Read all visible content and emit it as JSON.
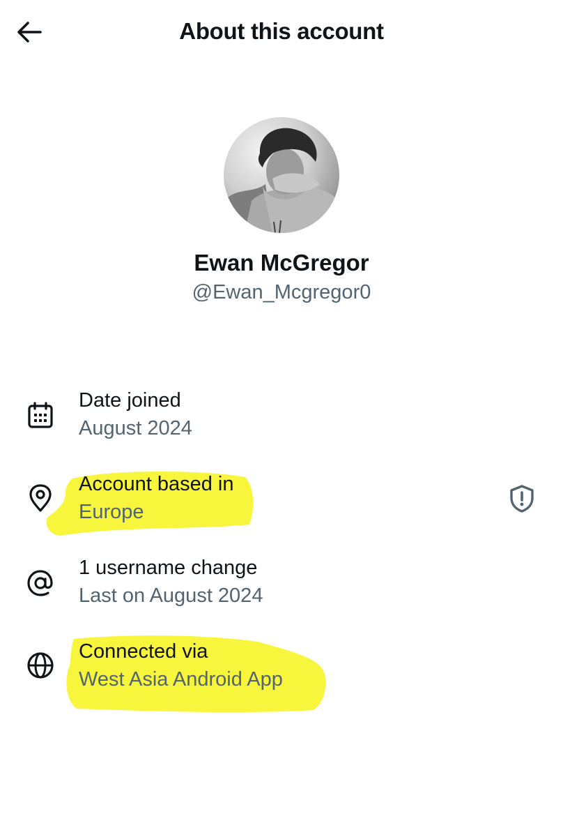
{
  "header": {
    "back_icon": "arrow-left-icon",
    "title": "About this account"
  },
  "profile": {
    "name": "Ewan McGregor",
    "handle": "@Ewan_Mcgregor0"
  },
  "rows": [
    {
      "icon": "calendar-icon",
      "label": "Date joined",
      "value": "August 2024",
      "highlighted": false
    },
    {
      "icon": "location-pin-icon",
      "label": "Account based in",
      "value": "Europe",
      "highlighted": true
    },
    {
      "icon": "at-sign-icon",
      "label": "1 username change",
      "value": "Last on August 2024",
      "highlighted": false
    },
    {
      "icon": "globe-icon",
      "label": "Connected via",
      "value": "West Asia Android App",
      "highlighted": true
    }
  ],
  "shield_icon": "shield-alert-icon",
  "colors": {
    "primary_text": "#0f1419",
    "secondary_text": "#536471",
    "highlighter": "#f6f52c"
  }
}
